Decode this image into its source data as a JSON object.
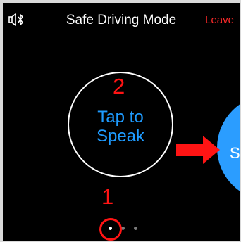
{
  "header": {
    "title": "Safe Driving Mode",
    "leave_label": "Leave",
    "left_icon": "bluetooth-audio-icon"
  },
  "speak_circle": {
    "label": "Tap to\nSpeak"
  },
  "next_circle": {
    "label": "S"
  },
  "annotations": {
    "step_1": "1",
    "step_2": "2",
    "annotation_color": "#ff1414"
  },
  "pager": {
    "total": 3,
    "active_index": 0
  },
  "colors": {
    "accent_blue": "#1e9bff",
    "leave_red": "#ff2a2a"
  }
}
